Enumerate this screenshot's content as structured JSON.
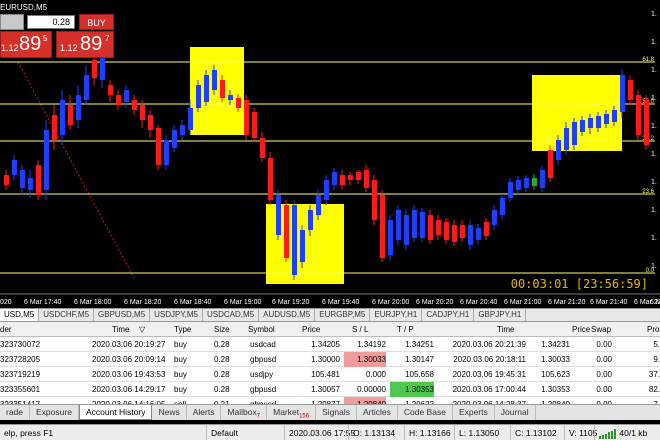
{
  "chart": {
    "title": "EURUSD,M5",
    "one_click": {
      "lot": "0.28",
      "buy_label": "BUY",
      "sell_prefix": "1.12",
      "sell_big": "89",
      "sell_sup": "5",
      "buy_prefix": "1.12",
      "buy_big": "89",
      "buy_sup": "7"
    },
    "price_labels": [
      "61.8",
      "50.0",
      "38.2",
      "23.6",
      "0.0"
    ],
    "right_axis_stub": [
      "1.",
      "1.",
      "1.",
      "1.",
      "1.",
      "1.",
      "1.",
      "1.",
      "1.",
      "1."
    ],
    "time_labels": [
      "020",
      "6 Mar 17:40",
      "6 Mar 18:00",
      "6 Mar 18:20",
      "6 Mar 18:40",
      "6 Mar 19:00",
      "6 Mar 19:20",
      "6 Mar 19:40",
      "6 Mar 20:00",
      "6 Mar 20:20",
      "6 Mar 20:40",
      "6 Mar 21:00",
      "6 Mar 21:20",
      "6 Mar 21:40",
      "6 Mar 22:00",
      "6 Mar"
    ],
    "timer": "00:03:01 [23:56:59]",
    "colors": {
      "bull": "#1f3fff",
      "bear": "#ff1a1a",
      "fib": "#ffff66",
      "zone": "#ffff00",
      "timer": "#e6b800"
    }
  },
  "symbol_tabs": [
    "USD,M5",
    "USDCHF,M5",
    "GBPUSD,M5",
    "USDJPY,M5",
    "USDCAD,M5",
    "AUDUSD,M5",
    "EURGBP,M5",
    "EURJPY,H1",
    "CADJPY,H1",
    "GBPJPY,H1"
  ],
  "table": {
    "headers": {
      "order": "der",
      "time": "Time",
      "sort": "▽",
      "type": "Type",
      "size": "Size",
      "symbol": "Symbol",
      "price": "Price",
      "sl": "S / L",
      "tp": "T / P",
      "time2": "Time",
      "price2": "Price",
      "swap": "Swap",
      "profit": "Pro"
    },
    "rows": [
      {
        "order": "323730072",
        "time": "2020.03.06 20:19:27",
        "type": "buy",
        "size": "0.28",
        "symbol": "usdcad",
        "price": "1.34205",
        "sl": "1.34192",
        "tp": "1.34251",
        "time2": "2020.03.06 20:21:39",
        "price2": "1.34231",
        "swap": "0.00",
        "profit": "5."
      },
      {
        "order": "323728205",
        "time": "2020.03.06 20:09:14",
        "type": "buy",
        "size": "0.28",
        "symbol": "gbpusd",
        "price": "1.30000",
        "sl": "1.30033",
        "tp": "1.30147",
        "time2": "2020.03.06 20:18:11",
        "price2": "1.30033",
        "swap": "0.00",
        "profit": "9."
      },
      {
        "order": "323719219",
        "time": "2020.03.06 19:43:53",
        "type": "buy",
        "size": "0.28",
        "symbol": "usdjpy",
        "price": "105.481",
        "sl": "0.000",
        "tp": "105.658",
        "time2": "2020.03.06 19:45:31",
        "price2": "105.623",
        "swap": "0.00",
        "profit": "37."
      },
      {
        "order": "323355601",
        "time": "2020.03.06 14:29:17",
        "type": "buy",
        "size": "0.28",
        "symbol": "gbpusd",
        "price": "1.30057",
        "sl": "0.00000",
        "tp": "1.30353",
        "time2": "2020.03.06 17:00:44",
        "price2": "1.30353",
        "swap": "0.00",
        "profit": "82."
      },
      {
        "order": "323351417",
        "time": "2020.03.06 14:16:05",
        "type": "sell",
        "size": "0.21",
        "symbol": "gbpusd",
        "price": "1.29877",
        "sl": "1.29840",
        "tp": "1.29622",
        "time2": "2020.03.06 14:28:37",
        "price2": "1.29840",
        "swap": "0.00",
        "profit": "7."
      }
    ]
  },
  "bottom_tabs": [
    {
      "label": "rade"
    },
    {
      "label": "Exposure"
    },
    {
      "label": "Account History",
      "active": true
    },
    {
      "label": "News"
    },
    {
      "label": "Alerts"
    },
    {
      "label": "Mailbox",
      "badge": "7"
    },
    {
      "label": "Market",
      "badge": "156"
    },
    {
      "label": "Signals"
    },
    {
      "label": "Articles"
    },
    {
      "label": "Code Base"
    },
    {
      "label": "Experts"
    },
    {
      "label": "Journal"
    }
  ],
  "status": {
    "help": "elp, press F1",
    "profile": "Default",
    "datetime": "2020.03.06 17:55",
    "open": "O: 1.13134",
    "high": "H: 1.13166",
    "low": "L: 1.13050",
    "close": "C: 1.13102",
    "volume": "V: 1105",
    "traffic": "40/1 kb"
  }
}
